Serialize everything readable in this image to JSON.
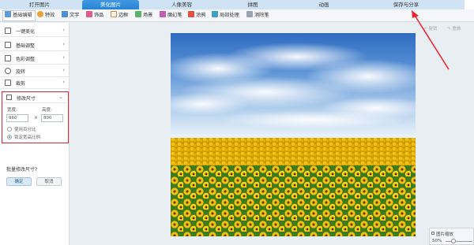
{
  "tabs": [
    {
      "label": "打开图片"
    },
    {
      "label": "美化图片"
    },
    {
      "label": "人像美容"
    },
    {
      "label": "拼图"
    },
    {
      "label": "动画"
    },
    {
      "label": "保存与分享"
    }
  ],
  "toolbar": {
    "items": [
      {
        "label": "基础编辑",
        "icon": "edit-icon"
      },
      {
        "label": "特效",
        "icon": "effects-icon"
      },
      {
        "label": "文字",
        "icon": "text-icon"
      },
      {
        "label": "饰品",
        "icon": "accessory-icon"
      },
      {
        "label": "边框",
        "icon": "frame-icon"
      },
      {
        "label": "场景",
        "icon": "scene-icon"
      },
      {
        "label": "魔幻笔",
        "icon": "magic-pen-icon"
      },
      {
        "label": "涂鸦",
        "icon": "graffiti-icon"
      },
      {
        "label": "局部处理",
        "icon": "local-icon"
      },
      {
        "label": "消除笔",
        "icon": "eraser-icon"
      }
    ]
  },
  "sidebar": {
    "items": [
      {
        "label": "一键美化"
      },
      {
        "label": "基础调整"
      },
      {
        "label": "色彩调整"
      },
      {
        "label": "旋转"
      },
      {
        "label": "裁剪"
      }
    ],
    "resize": {
      "title": "修改尺寸",
      "width_label": "宽度:",
      "height_label": "高度:",
      "width_value": "960",
      "height_value": "800",
      "times": "×",
      "use_percent": "使用百分比",
      "lock_ratio": "锁定宽高比例"
    },
    "batch_label": "批量修改尺寸?",
    "ok_label": "确定",
    "cancel_label": "取消"
  },
  "history": {
    "undo": "撤销",
    "redo": "重做"
  },
  "zoom": {
    "title": "图片缩放",
    "value": "50%"
  },
  "colors": {
    "accent": "#2a84d3",
    "highlight": "#e8282e"
  }
}
